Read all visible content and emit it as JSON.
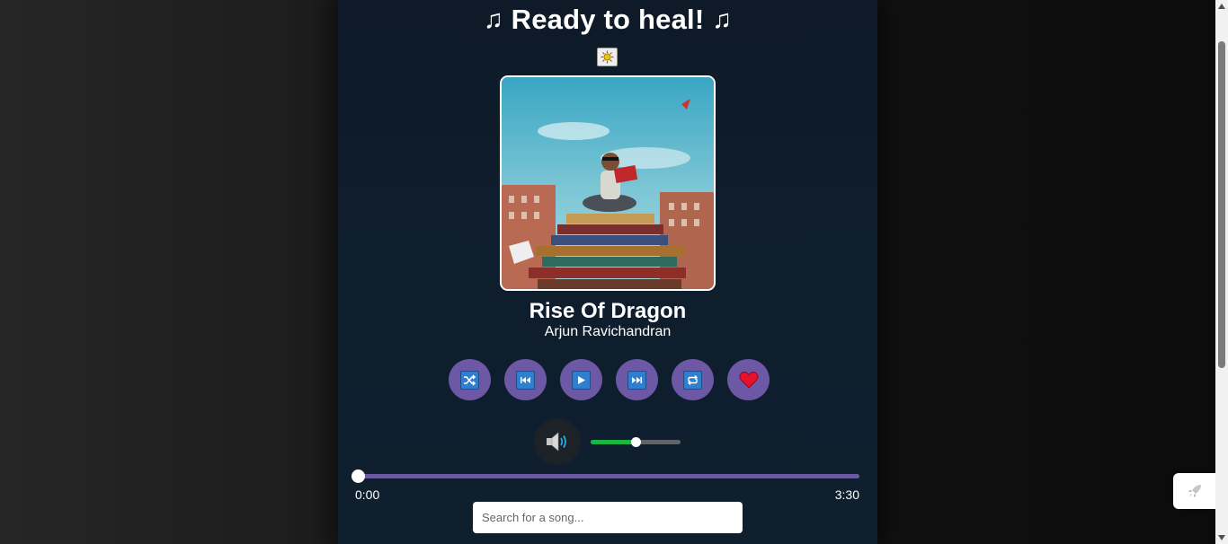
{
  "header": {
    "title": "Ready to heal!",
    "note_glyph": "♫"
  },
  "theme_toggle": {
    "icon": "sun-icon"
  },
  "now_playing": {
    "title": "Rise Of Dragon",
    "artist": "Arjun Ravichandran",
    "cover_icon": "album-cover-image"
  },
  "controls": [
    {
      "name": "shuffle-button",
      "icon": "shuffle-icon"
    },
    {
      "name": "previous-button",
      "icon": "previous-track-icon"
    },
    {
      "name": "play-button",
      "icon": "play-icon"
    },
    {
      "name": "next-button",
      "icon": "next-track-icon"
    },
    {
      "name": "repeat-button",
      "icon": "repeat-icon"
    },
    {
      "name": "favorite-button",
      "icon": "heart-icon"
    }
  ],
  "volume": {
    "icon": "speaker-icon",
    "level": 0.5
  },
  "progress": {
    "current": "0:00",
    "total": "3:30",
    "fraction": 0.0
  },
  "search": {
    "placeholder": "Search for a song..."
  },
  "colors": {
    "button_bg": "#6c58a4",
    "volume_fill": "#1db446",
    "seek_track": "#6b59a0",
    "player_bg": "#0f1e2d"
  }
}
